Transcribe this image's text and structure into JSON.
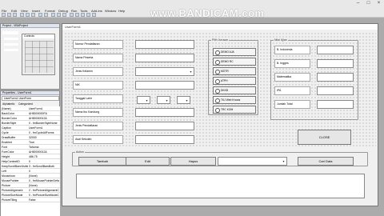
{
  "watermark": "www.BANDICAM.com",
  "menu": [
    "File",
    "Edit",
    "View",
    "Insert",
    "Format",
    "Debug",
    "Run",
    "Tools",
    "Add-Ins",
    "Window",
    "Help"
  ],
  "project_panel": {
    "title": "Project - VBAProject",
    "toolbox_title": "Controls"
  },
  "properties_panel": {
    "title": "Properties - UserForm1",
    "object": "UserForm1 UserForm",
    "tabs": [
      "Alphabetic",
      "Categorized"
    ],
    "rows": [
      {
        "k": "(Name)",
        "v": "UserForm1"
      },
      {
        "k": "BackColor",
        "v": "&H8000000F&"
      },
      {
        "k": "BorderColor",
        "v": "&H80000012&"
      },
      {
        "k": "BorderStyle",
        "v": "0 - fmBorderStyleNone"
      },
      {
        "k": "Caption",
        "v": "UserForm1"
      },
      {
        "k": "Cycle",
        "v": "0 - fmCycleAllForms"
      },
      {
        "k": "DrawBuffer",
        "v": "32000"
      },
      {
        "k": "Enabled",
        "v": "True"
      },
      {
        "k": "Font",
        "v": "Tahoma"
      },
      {
        "k": "ForeColor",
        "v": "&H80000012&"
      },
      {
        "k": "Height",
        "v": "486.75"
      },
      {
        "k": "HelpContextID",
        "v": "0"
      },
      {
        "k": "KeepScrollBarsVisible",
        "v": "3 - fmScrollBarsBoth"
      },
      {
        "k": "Left",
        "v": "0"
      },
      {
        "k": "MouseIcon",
        "v": "(None)"
      },
      {
        "k": "MousePointer",
        "v": "0 - fmMousePointerDefault"
      },
      {
        "k": "Picture",
        "v": "(None)"
      },
      {
        "k": "PictureAlignment",
        "v": "2 - fmPictureAlignmentCenter"
      },
      {
        "k": "PictureSizeMode",
        "v": "0 - fmPictureSizeModeClip"
      },
      {
        "k": "PictureTiling",
        "v": "False"
      }
    ]
  },
  "form": {
    "title": "UserForm1",
    "labels": [
      "Nomor Pendaftaran",
      "Nama Peserta",
      "Jenis Kelamin",
      "NIK",
      "Tanggal Lahir",
      "Nama Ibu Kandung",
      "Jenis Pendaftaran",
      "Asal Sekolah"
    ],
    "jurusan_frame": "Pilih Jurusan",
    "jurusan_options": [
      "DEMO AJA",
      "DEMO RC",
      "MOTR",
      "ATPH",
      "DKKB",
      "TKJ Web Knows",
      "TRC KOM"
    ],
    "nilai_frame": "Nilai Ujian",
    "nilai_labels": [
      "B. Indonesia",
      "B. Inggris",
      "Matematika",
      "IPA",
      "Jumlah Total"
    ],
    "close_label": "CLOSE",
    "aksi_frame": "Action",
    "buttons": {
      "tambah": "Tambah",
      "edit": "Edit",
      "hapus": "Hapus",
      "cari": "Cari Data"
    }
  }
}
